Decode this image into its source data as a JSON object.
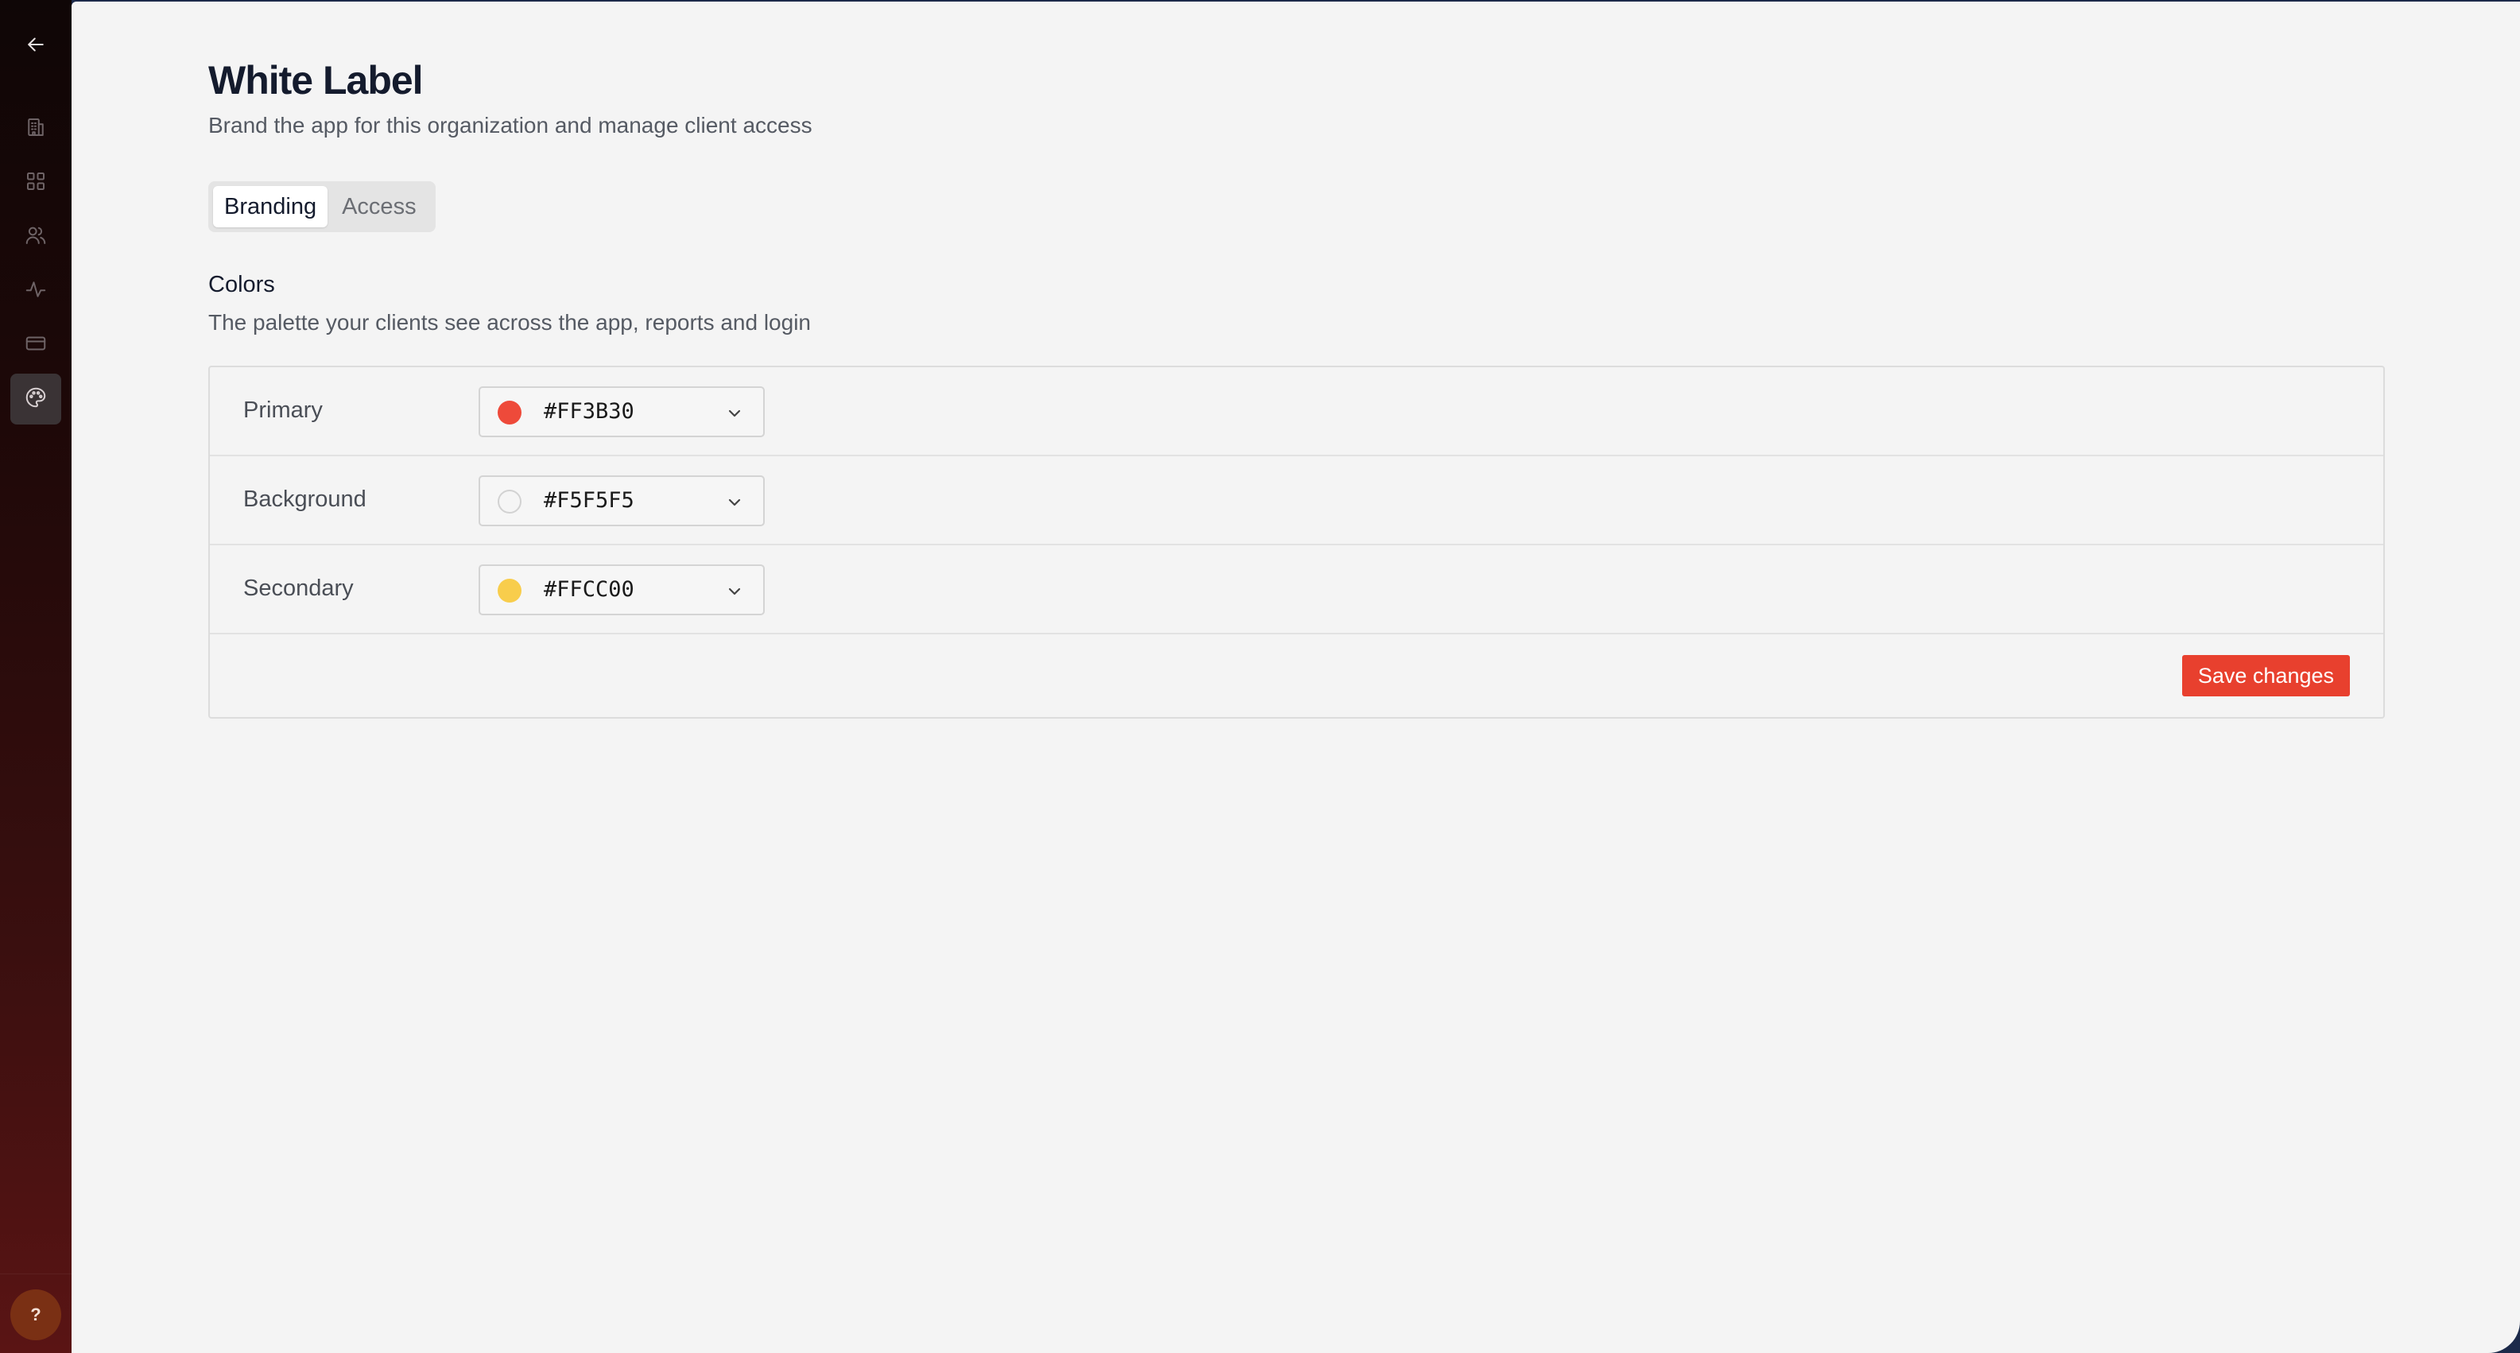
{
  "sidebar": {
    "items": [
      {
        "name": "back",
        "icon": "arrow-left-icon"
      },
      {
        "name": "organizations",
        "icon": "building-icon"
      },
      {
        "name": "apps",
        "icon": "grid-icon"
      },
      {
        "name": "users",
        "icon": "users-icon"
      },
      {
        "name": "activity",
        "icon": "activity-icon"
      },
      {
        "name": "billing",
        "icon": "credit-card-icon"
      },
      {
        "name": "white-label",
        "icon": "palette-icon",
        "active": true
      }
    ],
    "help_label": "?"
  },
  "header": {
    "title": "White Label",
    "subtitle": "Brand the app for this organization and manage client access"
  },
  "tabs": [
    {
      "label": "Branding",
      "active": true
    },
    {
      "label": "Access",
      "active": false
    }
  ],
  "colors_section": {
    "title": "Colors",
    "subtitle": "The palette your clients see across the app, reports and login",
    "rows": [
      {
        "label": "Primary",
        "value": "#FF3B30",
        "swatch": "#EE4A3A"
      },
      {
        "label": "Background",
        "value": "#F5F5F5",
        "swatch": "#F5F5F5"
      },
      {
        "label": "Secondary",
        "value": "#FFCC00",
        "swatch": "#F8CD4C"
      }
    ],
    "save_label": "Save changes"
  },
  "theme": {
    "accent": "#E8402E",
    "page_bg": "#F4F4F4"
  }
}
